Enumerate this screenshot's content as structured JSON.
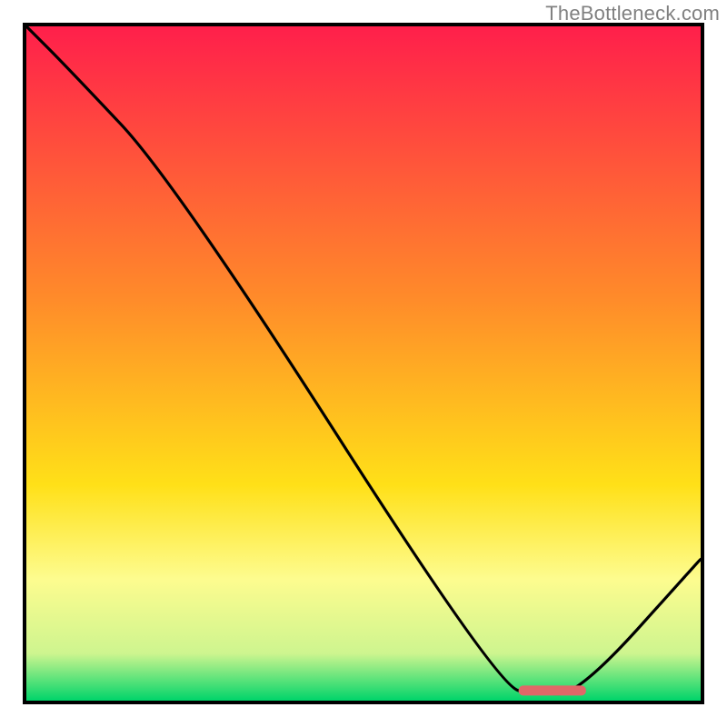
{
  "watermark": "TheBottleneck.com",
  "chart_data": {
    "type": "line",
    "title": "",
    "xlabel": "",
    "ylabel": "",
    "xlim": [
      0,
      100
    ],
    "ylim": [
      0,
      100
    ],
    "gradient_stops": [
      {
        "offset": 0,
        "color": "#ff1f4b"
      },
      {
        "offset": 40,
        "color": "#ff8a2a"
      },
      {
        "offset": 68,
        "color": "#ffe018"
      },
      {
        "offset": 82,
        "color": "#fdfc8f"
      },
      {
        "offset": 93,
        "color": "#cef58f"
      },
      {
        "offset": 100,
        "color": "#00d46a"
      }
    ],
    "series": [
      {
        "name": "bottleneck-curve",
        "x": [
          0,
          6,
          22,
          70,
          76,
          82,
          100
        ],
        "y": [
          100,
          94,
          77,
          2,
          1,
          1,
          21
        ]
      }
    ],
    "marker": {
      "name": "optimal-range",
      "x_start": 73,
      "x_end": 83,
      "y": 1.5,
      "color": "#e06868"
    }
  }
}
